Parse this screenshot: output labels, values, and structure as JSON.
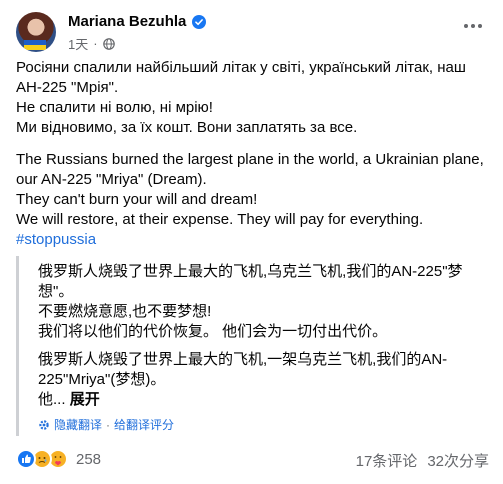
{
  "post": {
    "author": "Mariana Bezuhla",
    "time": "1天",
    "paragraph_uk": [
      "Росіяни спалили найбільший літак у світі, український літак, наш АН-225 \"Мрія\".",
      "Не спалити ні волю, ні мрію!",
      "Ми відновимо, за їх кошт. Вони заплатять за все."
    ],
    "paragraph_en": [
      "The Russians burned the largest plane in the world, a Ukrainian plane, our AN-225 \"Mriya\" (Dream).",
      "They can't burn your will and dream!",
      "We will restore, at their expense. They will pay for everything."
    ],
    "hashtag": "#stopрussia"
  },
  "translation": {
    "block1": [
      "俄罗斯人烧毁了世界上最大的飞机,乌克兰飞机,我们的AN-225\"梦想\"。",
      "不要燃烧意愿,也不要梦想!",
      "我们将以他们的代价恢复。 他们会为一切付出代价。"
    ],
    "block2_line1": "俄罗斯人烧毁了世界上最大的飞机,一架乌克兰飞机,我们的AN-225\"Mriya\"(梦想)。",
    "block2_line2": "他...",
    "see_more": "展开",
    "hide_label": "隐藏翻译",
    "rate_label": "给翻译评分",
    "separator": "·"
  },
  "footer": {
    "reaction_count": "258",
    "comments": "17条评论",
    "shares": "32次分享"
  },
  "colors": {
    "link": "#216fdb",
    "muted": "#65676b",
    "verified": "#1877f2"
  },
  "icons": [
    "verified-badge-icon",
    "globe-icon",
    "more-options-icon",
    "gear-icon",
    "like-reaction-icon",
    "sad-reaction-icon",
    "care-reaction-icon",
    "flag-emoji-ukraine"
  ]
}
